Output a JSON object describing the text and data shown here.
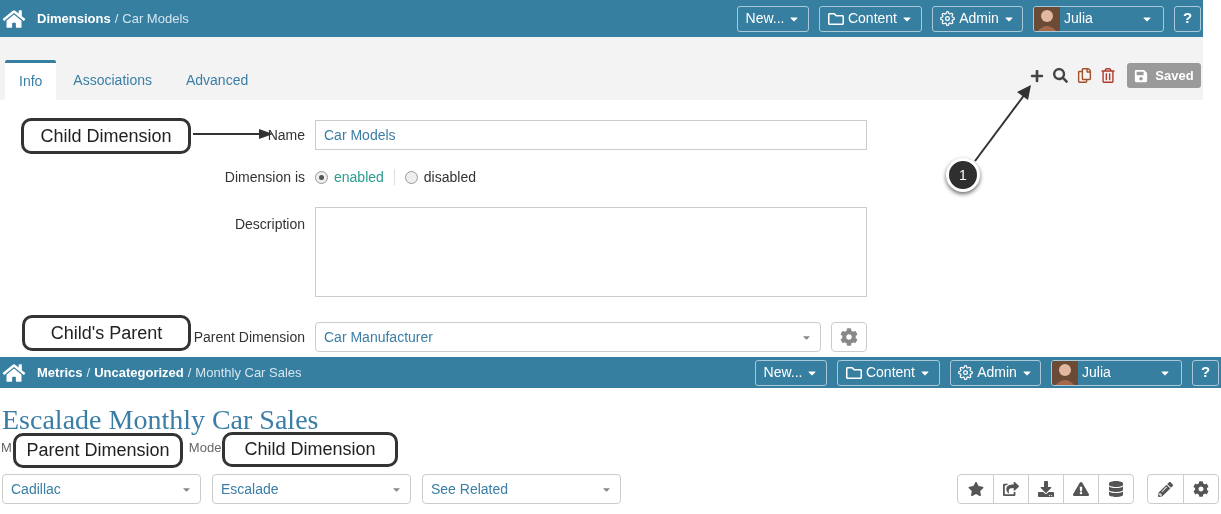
{
  "top_screen": {
    "header": {
      "separator": "/",
      "breadcrumb": [
        {
          "text": "Dimensions",
          "current": false
        },
        {
          "text": "Car Models",
          "current": true
        }
      ],
      "menus": [
        {
          "label": "New...",
          "kind": "plain"
        },
        {
          "label": "Content",
          "kind": "folder"
        },
        {
          "label": "Admin",
          "kind": "gear"
        }
      ],
      "user": "Julia",
      "help": "?"
    },
    "tabs": [
      {
        "label": "Info",
        "selected": true
      },
      {
        "label": "Associations",
        "selected": false
      },
      {
        "label": "Advanced",
        "selected": false
      }
    ],
    "saved_button": {
      "label": "Saved",
      "disabled": true
    },
    "form": {
      "name_label": "Name",
      "name_value": "Car Models",
      "status_label": "Dimension is",
      "status_options": [
        {
          "label": "enabled",
          "selected": true
        },
        {
          "label": "disabled",
          "selected": false
        }
      ],
      "description_label": "Description",
      "parent_label": "Parent Dimension",
      "parent_value": "Car Manufacturer"
    }
  },
  "bottom_screen": {
    "header": {
      "separator": "/",
      "breadcrumb": [
        {
          "text": "Metrics",
          "current": false
        },
        {
          "text": "Uncategorized",
          "current": false
        },
        {
          "text": "Monthly Car Sales",
          "current": true
        }
      ],
      "menus": [
        {
          "label": "New...",
          "kind": "plain"
        },
        {
          "label": "Content",
          "kind": "folder"
        },
        {
          "label": "Admin",
          "kind": "gear"
        }
      ],
      "user": "Julia",
      "help": "?"
    },
    "title": "Escalade Monthly Car Sales",
    "subtitle_fragments": [
      "M",
      "Mode"
    ],
    "dropdowns": [
      "Cadillac",
      "Escalade",
      "See Related"
    ]
  },
  "annotations": {
    "callouts": [
      {
        "text": "Child Dimension"
      },
      {
        "text": "Child's Parent"
      },
      {
        "text": "Parent Dimension"
      },
      {
        "text": "Child Dimension"
      }
    ],
    "marker": "1"
  }
}
